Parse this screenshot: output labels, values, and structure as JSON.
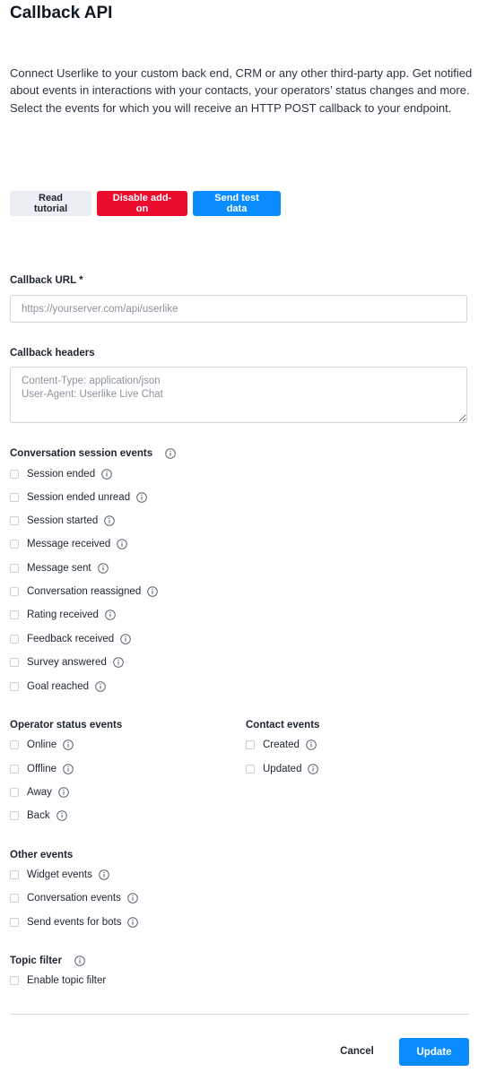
{
  "page": {
    "title": "Callback API",
    "intro": "Connect Userlike to your custom back end, CRM or any other third-party app. Get notified about events in interactions with your contacts, your operators’ status changes and more. Select the events for which you will receive an HTTP POST callback to your endpoint."
  },
  "buttons": {
    "read_tutorial": "Read tutorial",
    "disable_addon": "Disable add-on",
    "send_test_data": "Send test data"
  },
  "callback_url": {
    "label": "Callback URL *",
    "value": "",
    "placeholder": "https://yourserver.com/api/userlike"
  },
  "callback_headers": {
    "label": "Callback headers",
    "value": "",
    "placeholder": "Content-Type: application/json\nUser-Agent: Userlike Live Chat"
  },
  "conversation_session_events": {
    "title": "Conversation session events",
    "items": [
      {
        "label": "Session ended",
        "checked": false
      },
      {
        "label": "Session ended unread",
        "checked": false
      },
      {
        "label": "Session started",
        "checked": false
      },
      {
        "label": "Message received",
        "checked": false
      },
      {
        "label": "Message sent",
        "checked": false
      },
      {
        "label": "Conversation reassigned",
        "checked": false
      },
      {
        "label": "Rating received",
        "checked": false
      },
      {
        "label": "Feedback received",
        "checked": false
      },
      {
        "label": "Survey answered",
        "checked": false
      },
      {
        "label": "Goal reached",
        "checked": false
      }
    ]
  },
  "operator_status_events": {
    "title": "Operator status events",
    "items": [
      {
        "label": "Online",
        "checked": false
      },
      {
        "label": "Offline",
        "checked": false
      },
      {
        "label": "Away",
        "checked": false
      },
      {
        "label": "Back",
        "checked": false
      }
    ]
  },
  "contact_events": {
    "title": "Contact events",
    "items": [
      {
        "label": "Created",
        "checked": false
      },
      {
        "label": "Updated",
        "checked": false
      }
    ]
  },
  "other_events": {
    "title": "Other events",
    "items": [
      {
        "label": "Widget events",
        "checked": false
      },
      {
        "label": "Conversation events",
        "checked": false
      },
      {
        "label": "Send events for bots",
        "checked": false
      }
    ]
  },
  "topic_filter": {
    "title": "Topic filter",
    "items": [
      {
        "label": "Enable topic filter",
        "checked": false
      }
    ]
  },
  "footer": {
    "cancel": "Cancel",
    "update": "Update"
  },
  "colors": {
    "primary": "#0a8cff",
    "danger": "#eb0c2e",
    "secondary_bg": "#ebeef2",
    "text": "#1d2530",
    "info_icon": "#5b6570"
  },
  "icons": {
    "info": "info-circle-icon"
  }
}
